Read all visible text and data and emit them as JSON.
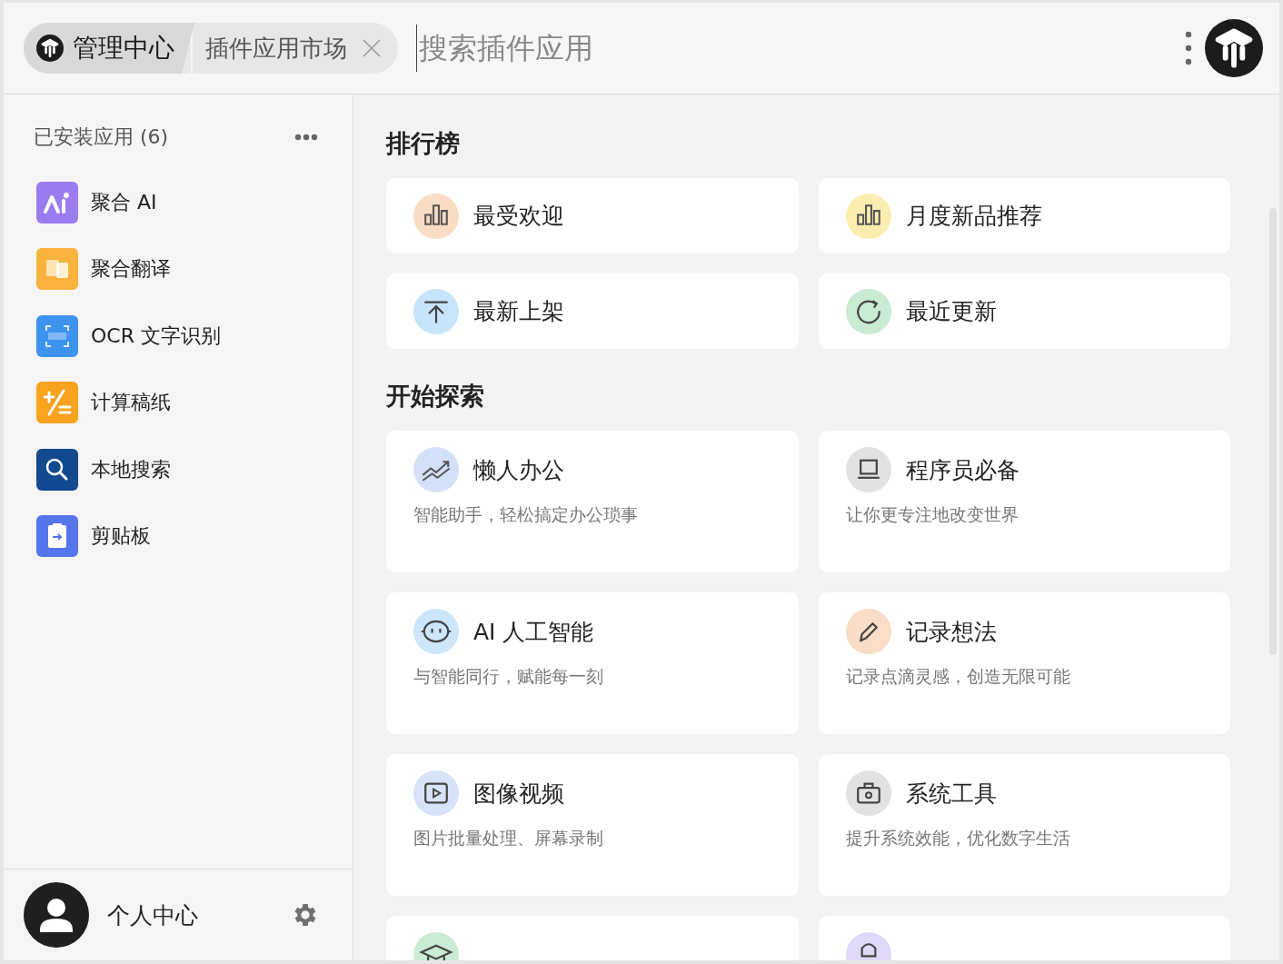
{
  "top_bar": {
    "breadcrumb": [
      {
        "label": "管理中心",
        "selected": true
      },
      {
        "label": "插件应用市场",
        "selected": false,
        "closable": true
      }
    ],
    "search": {
      "placeholder": "搜索插件应用"
    }
  },
  "sidebar": {
    "title": "已安装应用 (6)",
    "items": [
      {
        "label": "聚合 AI",
        "color": "#9b7cf0"
      },
      {
        "label": "聚合翻译",
        "color": "#f7b23b"
      },
      {
        "label": "OCR 文字识别",
        "color": "#3d94ee"
      },
      {
        "label": "计算稿纸",
        "color": "#f8a21e"
      },
      {
        "label": "本地搜索",
        "color": "#114a8f"
      },
      {
        "label": "剪贴板",
        "color": "#5575ea"
      }
    ],
    "user": {
      "label": "个人中心"
    }
  },
  "sections": [
    {
      "title": "排行榜",
      "kind": "ranking",
      "cards": [
        {
          "title": "最受欢迎",
          "color": "#f8dcc4"
        },
        {
          "title": "月度新品推荐",
          "color": "#fbedb0"
        },
        {
          "title": "最新上架",
          "color": "#c6e5fb"
        },
        {
          "title": "最近更新",
          "color": "#c8ebd2"
        }
      ]
    },
    {
      "title": "开始探索",
      "kind": "explore",
      "cards": [
        {
          "title": "懒人办公",
          "subtitle": "智能助手，轻松搞定办公琐事",
          "color": "#d3e1f8"
        },
        {
          "title": "程序员必备",
          "subtitle": "让你更专注地改变世界",
          "color": "#e2e2e2"
        },
        {
          "title": "AI 人工智能",
          "subtitle": "与智能同行，赋能每一刻",
          "color": "#cde6fa"
        },
        {
          "title": "记录想法",
          "subtitle": "记录点滴灵感，创造无限可能",
          "color": "#f9ddc6"
        },
        {
          "title": "图像视频",
          "subtitle": "图片批量处理、屏幕录制",
          "color": "#d6e3f8"
        },
        {
          "title": "系统工具",
          "subtitle": "提升系统效能，优化数字生活",
          "color": "#e2e2e2"
        },
        {
          "color": "#c9ecd3"
        },
        {
          "color": "#e0d8f7"
        }
      ]
    }
  ]
}
